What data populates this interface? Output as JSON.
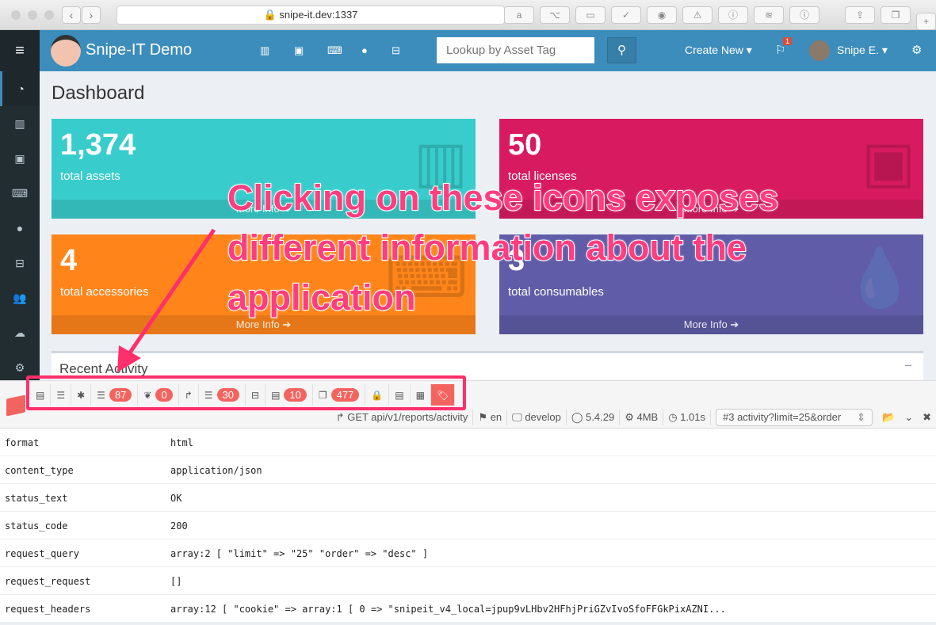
{
  "browser": {
    "url": "snipe-it.dev:1337"
  },
  "header": {
    "brand": "Snipe-IT Demo",
    "search_placeholder": "Lookup by Asset Tag",
    "create_new": "Create New",
    "notifications": "1",
    "user": "Snipe E."
  },
  "page": {
    "title": "Dashboard"
  },
  "stats": [
    {
      "value": "1,374",
      "label": "total assets",
      "more": "More Info",
      "color": "#39cccc"
    },
    {
      "value": "50",
      "label": "total licenses",
      "more": "More Info",
      "color": "#d81b60"
    },
    {
      "value": "4",
      "label": "total accessories",
      "more": "More Info",
      "color": "#ff851b"
    },
    {
      "value": "3",
      "label": "total consumables",
      "more": "More Info",
      "color": "#605ca8"
    }
  ],
  "recent": {
    "title": "Recent Activity",
    "minimize": "−"
  },
  "debugbar": {
    "tabs": [
      {
        "icon": "list-icon"
      },
      {
        "icon": "tasks-icon"
      },
      {
        "icon": "bug-icon"
      },
      {
        "icon": "tasks-icon",
        "badge": "87"
      },
      {
        "icon": "leaf-icon",
        "badge": "0"
      },
      {
        "icon": "share-icon"
      },
      {
        "icon": "database-icon",
        "badge": "30"
      },
      {
        "icon": "inbox-icon"
      },
      {
        "icon": "list-icon",
        "badge": "10"
      },
      {
        "icon": "files-icon",
        "badge": "477"
      },
      {
        "icon": "lock-icon"
      },
      {
        "icon": "list-icon"
      },
      {
        "icon": "archive-icon"
      },
      {
        "icon": "tags-icon",
        "active": true
      }
    ],
    "request": "GET api/v1/reports/activity",
    "locale": "en",
    "env": "develop",
    "version": "5.4.29",
    "memory": "4MB",
    "time": "1.01s",
    "selected_request": "#3 activity?limit=25&order"
  },
  "rows": [
    {
      "k": "format",
      "v": "html"
    },
    {
      "k": "content_type",
      "v": "application/json"
    },
    {
      "k": "status_text",
      "v": "OK"
    },
    {
      "k": "status_code",
      "v": "200"
    },
    {
      "k": "request_query",
      "v": "array:2 [ \"limit\" => \"25\" \"order\" => \"desc\" ]"
    },
    {
      "k": "request_request",
      "v": "[]"
    },
    {
      "k": "request_headers",
      "v": "array:12 [ \"cookie\" => array:1 [ 0 => \"snipeit_v4_local=jpup9vLHbv2HFhjPriGZvIvoSfoFFGkPixAZNI..."
    }
  ],
  "annotation": {
    "lines": [
      "Clicking on these icons exposes",
      "different information about the",
      "application"
    ],
    "color": "#ff3d7f"
  }
}
